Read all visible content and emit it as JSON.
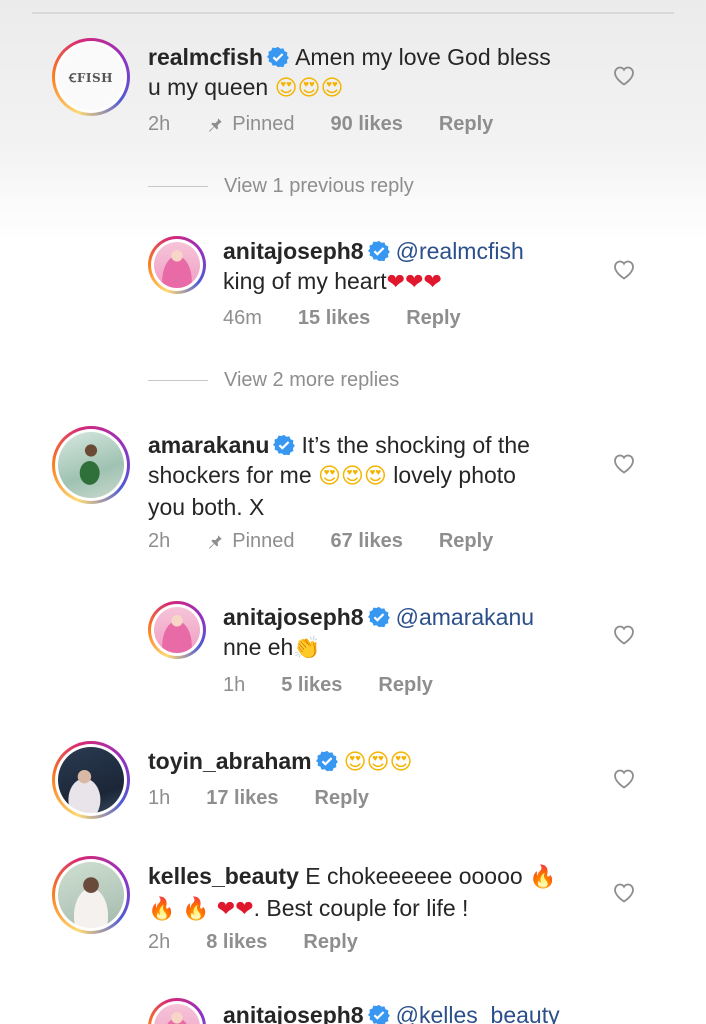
{
  "comments": [
    {
      "user": "realmcfish",
      "text": "Amen my love God bless",
      "text2": "u my queen",
      "emoji": "😍😍😍",
      "time": "2h",
      "pinned": "Pinned",
      "likes": "90 likes",
      "reply": "Reply",
      "avatar_text": "ꞒFISH"
    },
    {
      "view_replies": "View 1 previous reply"
    },
    {
      "user": "anitajoseph8",
      "mention": "@realmcfish",
      "text": "king of my heart",
      "emoji": "❤❤❤",
      "time": "46m",
      "likes": "15 likes",
      "reply": "Reply"
    },
    {
      "view_replies": "View 2 more replies"
    },
    {
      "user": "amarakanu",
      "text": "It’s the shocking of the",
      "text2a": "shockers for me",
      "emoji": "😍😍😍",
      "text2b": "lovely photo",
      "text3": "you both. X",
      "time": "2h",
      "pinned": "Pinned",
      "likes": "67 likes",
      "reply": "Reply"
    },
    {
      "user": "anitajoseph8",
      "mention": "@amarakanu",
      "text": "nne eh",
      "emoji": "👏",
      "time": "1h",
      "likes": "5 likes",
      "reply": "Reply"
    },
    {
      "user": "toyin_abraham",
      "emoji": "😍😍😍",
      "time": "1h",
      "likes": "17 likes",
      "reply": "Reply"
    },
    {
      "user": "kelles_beauty",
      "text": "E chokeeeeee ooooo",
      "emoji_fire1": "🔥",
      "emoji_line2": "🔥 🔥 ❤❤",
      "text2": ". Best couple for life !",
      "time": "2h",
      "likes": "8 likes",
      "reply": "Reply"
    },
    {
      "user": "anitajoseph8",
      "mention": "@kelles_beauty"
    }
  ],
  "colors": {
    "verified": "#3897f0",
    "mention": "#2b4f8a",
    "meta": "#8e8e8e"
  },
  "icons": {
    "verified": "verified-badge-icon",
    "pin": "pin-icon",
    "like": "heart-outline-icon"
  }
}
